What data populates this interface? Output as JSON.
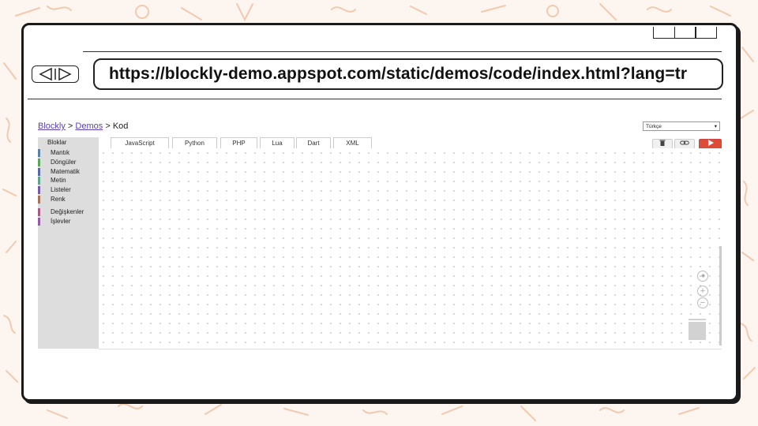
{
  "browser": {
    "url": "https://blockly-demo.appspot.com/static/demos/code/index.html?lang=tr"
  },
  "breadcrumb": {
    "blockly": "Blockly",
    "sep1": ">",
    "demos": "Demos",
    "sep2": ">",
    "current": "Kod"
  },
  "language_select": {
    "value": "Türkçe",
    "arrow": "▾"
  },
  "tabs": {
    "blocks": "Bloklar",
    "javascript": "JavaScript",
    "python": "Python",
    "php": "PHP",
    "lua": "Lua",
    "dart": "Dart",
    "xml": "XML"
  },
  "toolbar": {
    "trash_icon": "trash-icon",
    "link_icon": "link-icon",
    "run_icon": "play-icon",
    "run_color": "#dd4b39"
  },
  "toolbox": {
    "categories": [
      {
        "label": "Mantık",
        "color": "#5b80a5"
      },
      {
        "label": "Döngüler",
        "color": "#5ba55b"
      },
      {
        "label": "Matematik",
        "color": "#5b67a5"
      },
      {
        "label": "Metin",
        "color": "#5ba58c"
      },
      {
        "label": "Listeler",
        "color": "#745ba5"
      },
      {
        "label": "Renk",
        "color": "#a5745b"
      },
      {
        "label": "Değişkenler",
        "color": "#a55b80"
      },
      {
        "label": "İşlevler",
        "color": "#995ba5"
      }
    ]
  },
  "workspace": {
    "zoom_controls": [
      "zoom-reset-icon",
      "zoom-in-icon",
      "zoom-out-icon"
    ]
  }
}
